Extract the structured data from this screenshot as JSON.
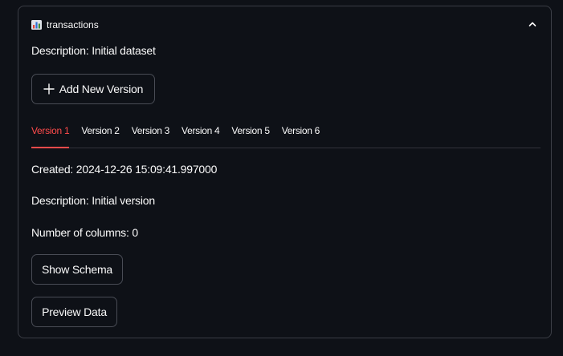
{
  "expander": {
    "icon": "bar-chart-icon",
    "title": "transactions",
    "toggle_icon": "chevron-up-icon",
    "expanded": true
  },
  "dataset": {
    "description": "Description: Initial dataset"
  },
  "add_version_button": {
    "icon": "plus-icon",
    "label": "Add New Version"
  },
  "tabs": [
    {
      "label": "Version 1",
      "active": true
    },
    {
      "label": "Version 2",
      "active": false
    },
    {
      "label": "Version 3",
      "active": false
    },
    {
      "label": "Version 4",
      "active": false
    },
    {
      "label": "Version 5",
      "active": false
    },
    {
      "label": "Version 6",
      "active": false
    }
  ],
  "version": {
    "created": "Created: 2024-12-26 15:09:41.997000",
    "description": "Description: Initial version",
    "num_columns": "Number of columns: 0"
  },
  "buttons": {
    "show_schema": "Show Schema",
    "preview_data": "Preview Data"
  },
  "colors": {
    "background": "#0e1117",
    "border": "#3a3d45",
    "text": "#fafafa",
    "accent": "#ff4b4b"
  }
}
